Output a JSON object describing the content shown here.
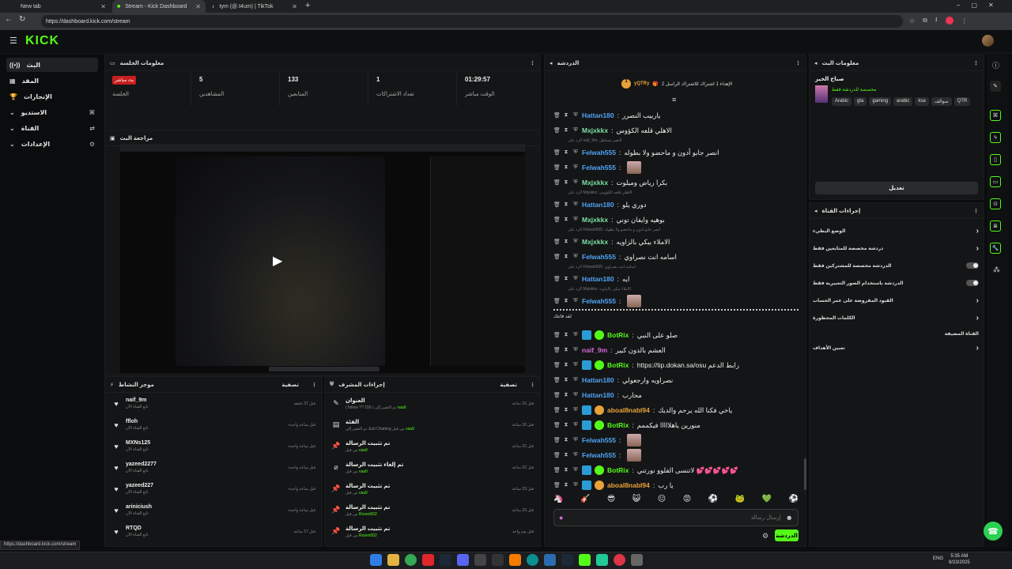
{
  "browser": {
    "tabs": [
      {
        "label": "New tab",
        "active": false
      },
      {
        "label": "Stream - Kick Dashboard",
        "active": true
      },
      {
        "label": "tym (@.t4um) | TikTok",
        "active": false
      }
    ],
    "url": "https://dashboard.kick.com/stream",
    "status_url": "https://dashboard.kick.com/stream"
  },
  "app": {
    "logo": "KICK"
  },
  "sidebar": {
    "items": [
      {
        "label": "البث",
        "icon": "broadcast-icon"
      },
      {
        "label": "المقد",
        "icon": "dashboard-icon"
      },
      {
        "label": "الإنجازات",
        "icon": "trophy-icon"
      },
      {
        "label": "الاستديو",
        "icon": "studio-icon"
      },
      {
        "label": "القناة",
        "icon": "channel-icon"
      },
      {
        "label": "الإعدادات",
        "icon": "settings-icon"
      }
    ]
  },
  "session": {
    "title": "معلومات الجلسة",
    "live_badge": "بث مباشر",
    "stats": [
      {
        "label": "الجلسة",
        "value": ""
      },
      {
        "label": "المشاهدين",
        "value": "5"
      },
      {
        "label": "المتابعين",
        "value": "133"
      },
      {
        "label": "تعداد الاشتراكات",
        "value": "1"
      },
      {
        "label": "الوقت مباشر",
        "value": "01:29:57"
      }
    ]
  },
  "preview": {
    "title": "مراجعة البث"
  },
  "activity": {
    "title": "موجز النشاط",
    "filter": "تصفية",
    "items": [
      {
        "name": "naif_9m",
        "sub": "تابع القناة الآن",
        "time": "قبل 37 دقيقة"
      },
      {
        "name": "ffloh",
        "sub": "تابع القناة الآن",
        "time": "قبل ساعة واحدة"
      },
      {
        "name": "MXNs125",
        "sub": "تابع القناة الآن",
        "time": "قبل ساعة واحدة"
      },
      {
        "name": "yazeed2277",
        "sub": "تابع القناة الآن",
        "time": "قبل ساعة واحدة"
      },
      {
        "name": "yazeed227",
        "sub": "تابع القناة الآن",
        "time": "قبل ساعة واحدة"
      },
      {
        "name": "ariniciush",
        "sub": "تابع القناة الآن",
        "time": "قبل ساعة واحدة"
      },
      {
        "name": "RTQD",
        "sub": "تابع القناة الآن",
        "time": "قبل 17 ساعة"
      }
    ]
  },
  "mod_actions": {
    "title": "إجراءات المشرف",
    "filter": "تصفية",
    "items": [
      {
        "name": "العنوان",
        "sub": "( follow ?? 150 ) تم التغيير إلى",
        "by": "vaa9",
        "time": "قبل 16 ساعة"
      },
      {
        "name": "الفئة",
        "sub": "تم التغيير إلى Just Chatting من قبل",
        "by": "vaa9",
        "time": "قبل 18 ساعة"
      },
      {
        "name": "تم تثبيت الرسالة",
        "sub": "من قبل",
        "by": "vaa9",
        "time": "قبل 22 ساعة"
      },
      {
        "name": "تم إلغاء تثبيت الرسالة",
        "sub": "من قبل",
        "by": "vaa9",
        "time": "قبل 22 ساعة"
      },
      {
        "name": "تم تثبيت الرسالة",
        "sub": "من قبل",
        "by": "vaa9",
        "time": "قبل 23 ساعة"
      },
      {
        "name": "تم تثبيت الرسالة",
        "sub": "من قبل",
        "by": "Roxen502",
        "time": "قبل 23 ساعة"
      },
      {
        "name": "تم تثبيت الرسالة",
        "sub": "من قبل",
        "by": "Roxen502",
        "time": "قبل يوم واحد"
      }
    ]
  },
  "chat": {
    "title": "الدردشة",
    "top_user": "yQTRy",
    "top_count": "1",
    "pinned_note": "الإهداء 1 اشتراك للاشتراك الراسل 2",
    "messages": [
      {
        "type": "msg",
        "user": "Hattan180",
        "color": "#4ea4f5",
        "text": "ياربيب النصرر"
      },
      {
        "type": "msg",
        "user": "Mxjxkkx",
        "color": "#7ce0a7",
        "text": "الاهلي قلعه الكؤوس"
      },
      {
        "type": "reply",
        "text": "الرد على naif_9m: النصر يستاهل"
      },
      {
        "type": "msg",
        "user": "Felwah555",
        "color": "#4ea4f5",
        "text": "انصر جابو أدون و ماحضو ولا بطوله"
      },
      {
        "type": "msg",
        "user": "Felwah555",
        "color": "#4ea4f5",
        "text": ""
      },
      {
        "type": "msg",
        "user": "Mxjxkkx",
        "color": "#7ce0a7",
        "text": "بكرا رياض وميلوت"
      },
      {
        "type": "reply",
        "text": "الرد على Mxjxkkx: الاهلي قلعه الكؤوس"
      },
      {
        "type": "msg",
        "user": "Hattan180",
        "color": "#4ea4f5",
        "text": "دوري يلو"
      },
      {
        "type": "msg",
        "user": "Mxjxkkx",
        "color": "#7ce0a7",
        "text": "بوهيه وايفان توني"
      },
      {
        "type": "reply",
        "text": "الرد على Felwah555: انصر جابو أدون و ماحضو ولا بطوله"
      },
      {
        "type": "msg",
        "user": "Mxjxkkx",
        "color": "#7ce0a7",
        "text": "الاملاء بيكي بالزاويه"
      },
      {
        "type": "msg",
        "user": "Felwah555",
        "color": "#4ea4f5",
        "text": "اسامه انت نصراوي"
      },
      {
        "type": "reply",
        "text": "الرد على Felwah555: اسامه انت نصراوي"
      },
      {
        "type": "msg",
        "user": "Hattan180",
        "color": "#4ea4f5",
        "text": "ايه"
      },
      {
        "type": "reply",
        "text": "الرد على Mxjxkkx: الاملاء بيكي بالزاويه"
      },
      {
        "type": "msg",
        "user": "Felwah555",
        "color": "#4ea4f5",
        "text": ""
      },
      {
        "type": "divider",
        "text": "لقد فاتتك"
      },
      {
        "type": "msg",
        "user": "BotRix",
        "color": "#53fc18",
        "text": "صلو على النبي"
      },
      {
        "type": "msg",
        "user": "naif_9m",
        "color": "#d36bd6",
        "text": "العشم بالدون كبير"
      },
      {
        "type": "msg",
        "user": "BotRix",
        "color": "#53fc18",
        "text": "https://tip.dokan.sa/osu رابط الدعم"
      },
      {
        "type": "msg",
        "user": "Hattan180",
        "color": "#4ea4f5",
        "text": "نصراويه وارجعولي"
      },
      {
        "type": "msg",
        "user": "Hattan180",
        "color": "#4ea4f5",
        "text": "محارب"
      },
      {
        "type": "msg",
        "user": "aboal8nabl94",
        "color": "#e8a23a",
        "text": "ياخي فكنا الله يرحم والديك"
      },
      {
        "type": "msg",
        "user": "BotRix",
        "color": "#53fc18",
        "text": "منورين ياهلااااا فيكممم"
      },
      {
        "type": "msg",
        "user": "Felwah555",
        "color": "#4ea4f5",
        "text": ""
      },
      {
        "type": "msg",
        "user": "Felwah555",
        "color": "#4ea4f5",
        "text": ""
      },
      {
        "type": "msg",
        "user": "BotRix",
        "color": "#53fc18",
        "text": "لاتنسى الفلوو نورتني 💕💕💕💕💕"
      },
      {
        "type": "msg",
        "user": "aboal8nabl94",
        "color": "#e8a23a",
        "text": "يا رب"
      }
    ],
    "input_placeholder": "إرسال رسالة",
    "send_label": "الدردشة"
  },
  "stream_info": {
    "title": "معلومات البث",
    "stream_title": "صباح الخير",
    "category": "مخصصة للدردشة فقط",
    "tags": [
      "Arabic",
      "gta",
      "gaming",
      "arabic",
      "ksa",
      "سوالف",
      "QTR"
    ],
    "edit_label": "تعديل"
  },
  "channel_actions": {
    "title": "إجراءات القناة",
    "rows": [
      {
        "label": "الوضع البطيء",
        "control": "chevron"
      },
      {
        "label": "دردشة مخصصة للمتابعين فقط",
        "control": "chevron"
      },
      {
        "label": "الدردشة مخصصة للمشتركين فقط",
        "control": "toggle"
      },
      {
        "label": "الدردشة باستخدام الصور التعبيرية فقط",
        "control": "toggle"
      },
      {
        "label": "القيود المفروضة على عمر الحساب",
        "control": "chevron"
      },
      {
        "label": "الكلمات المحظورة",
        "control": "chevron"
      },
      {
        "label": "القناة المضيفة",
        "control": "none"
      },
      {
        "label": "تعيين الأهداف",
        "control": "chevron"
      }
    ]
  },
  "taskbar": {
    "time": "5:35 AM",
    "date": "8/23/2025",
    "lang": "ENG"
  },
  "colors": {
    "accent": "#53fc18",
    "live": "#c81e1e",
    "panel": "#141516",
    "bg": "#0b0c0d"
  }
}
